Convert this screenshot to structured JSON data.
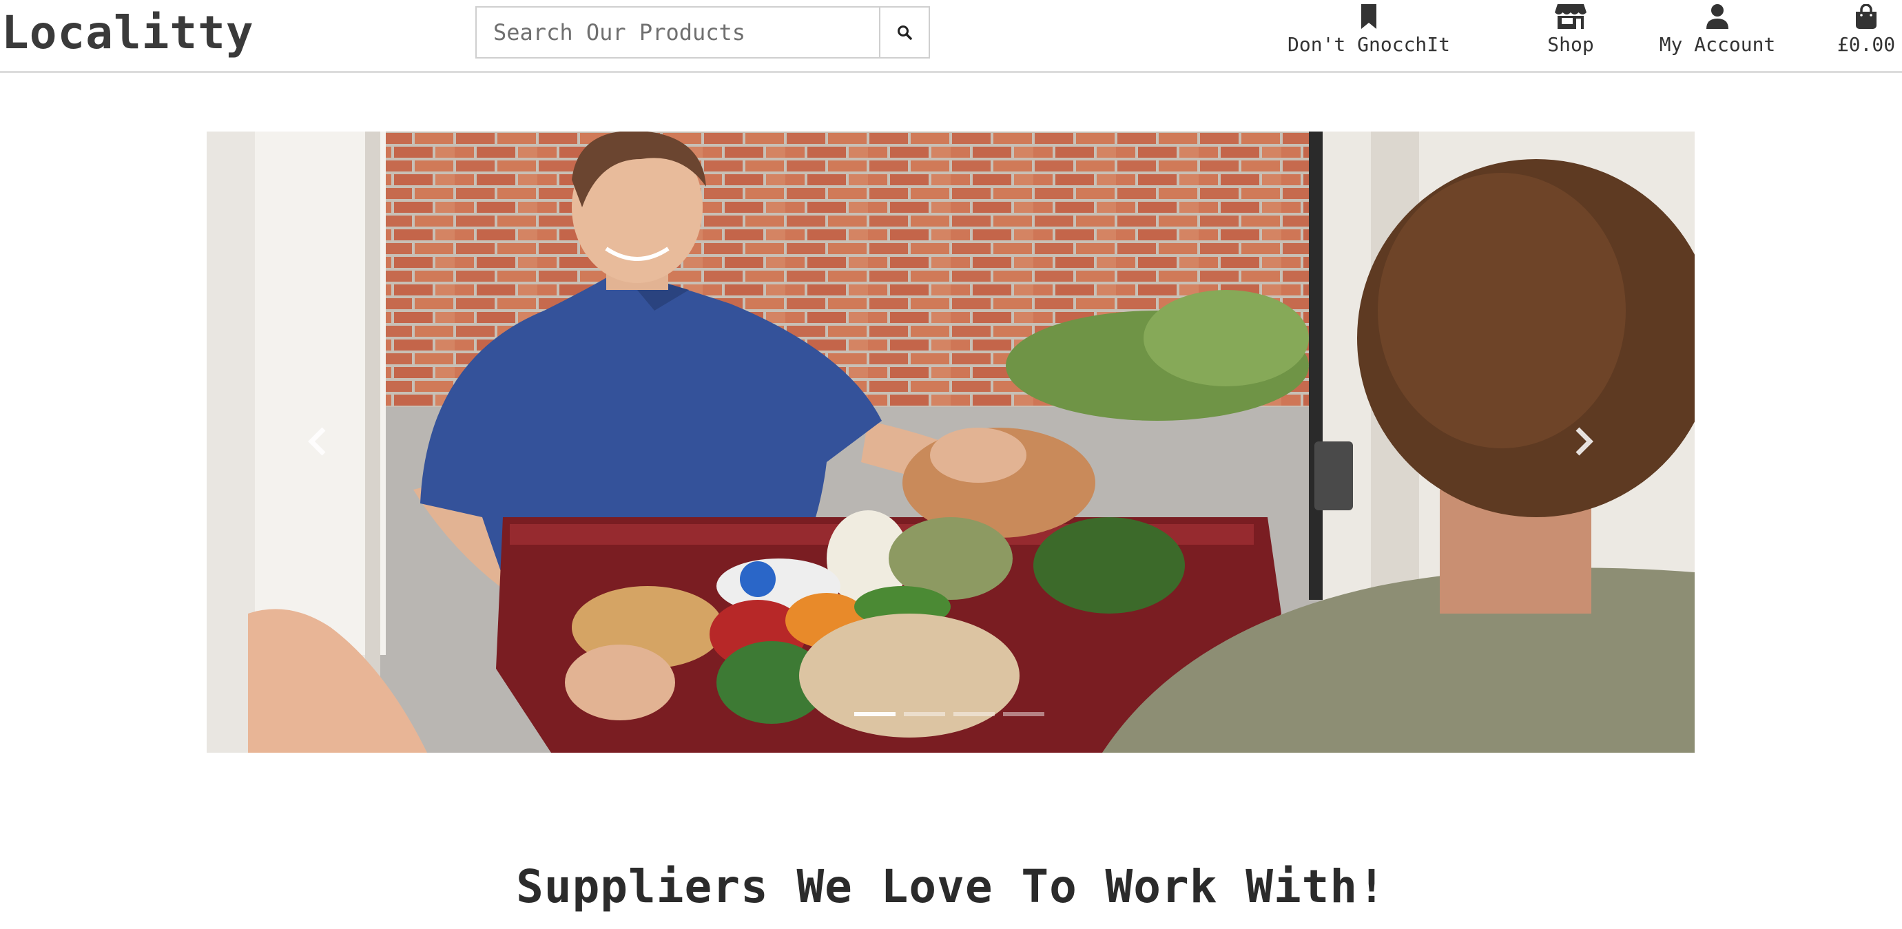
{
  "header": {
    "logo": "Localitty",
    "search": {
      "placeholder": "Search Our Products",
      "value": ""
    },
    "nav": [
      {
        "label": "Don't GnocchIt",
        "icon": "bookmark-icon"
      },
      {
        "label": "Shop",
        "icon": "store-icon"
      },
      {
        "label": "My Account",
        "icon": "user-icon"
      },
      {
        "label": "£0.00",
        "icon": "shopping-bag-icon"
      }
    ]
  },
  "carousel": {
    "slide_count": 4,
    "active_index": 0,
    "image_subject": "delivery-person-handing-grocery-crate",
    "prev_icon": "chevron-left-icon",
    "next_icon": "chevron-right-icon"
  },
  "main": {
    "section_title": "Suppliers We Love To Work With!"
  },
  "colors": {
    "text": "#333333",
    "header_border": "#dcdcdc",
    "search_border": "#cfcfcf"
  }
}
